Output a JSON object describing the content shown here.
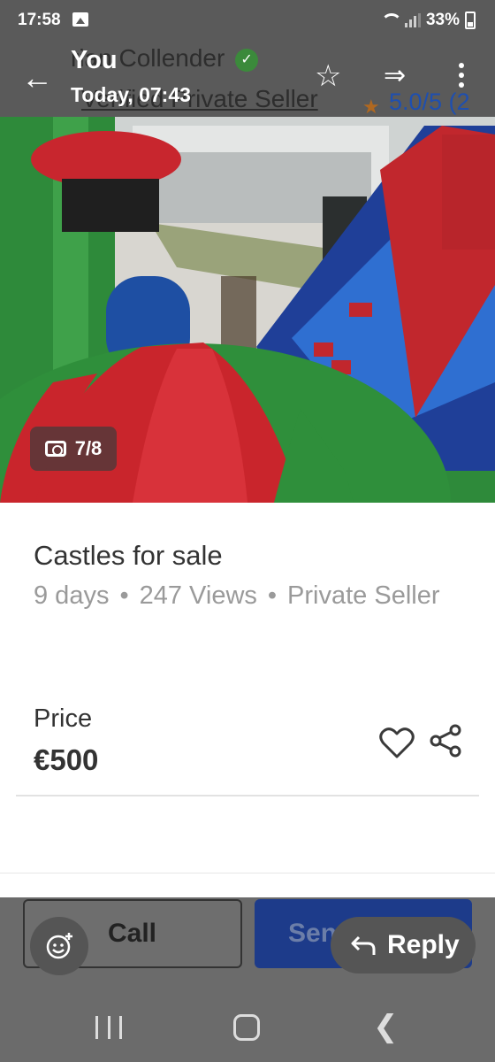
{
  "status_bar": {
    "time": "17:58",
    "battery": "33%"
  },
  "header": {
    "seller_name": "rian Collender",
    "seller_type": "Verified Private Seller",
    "rating": "5.0/5 (2",
    "overlay_sender": "You",
    "overlay_time": "Today, 07:43"
  },
  "photo": {
    "counter": "7/8"
  },
  "listing": {
    "title": "Castles for sale",
    "age": "9 days",
    "views": "247 Views",
    "seller": "Private Seller",
    "separator": "•",
    "price_label": "Price",
    "price": "€500"
  },
  "actions": {
    "call_label": "Call",
    "send_label": "Send Me...",
    "reply_label": "Reply"
  },
  "colors": {
    "header_bg": "#5a5a5a",
    "send_button": "#1d3b8a",
    "verified": "#3b8a3b",
    "rating": "#1e4fb0"
  }
}
